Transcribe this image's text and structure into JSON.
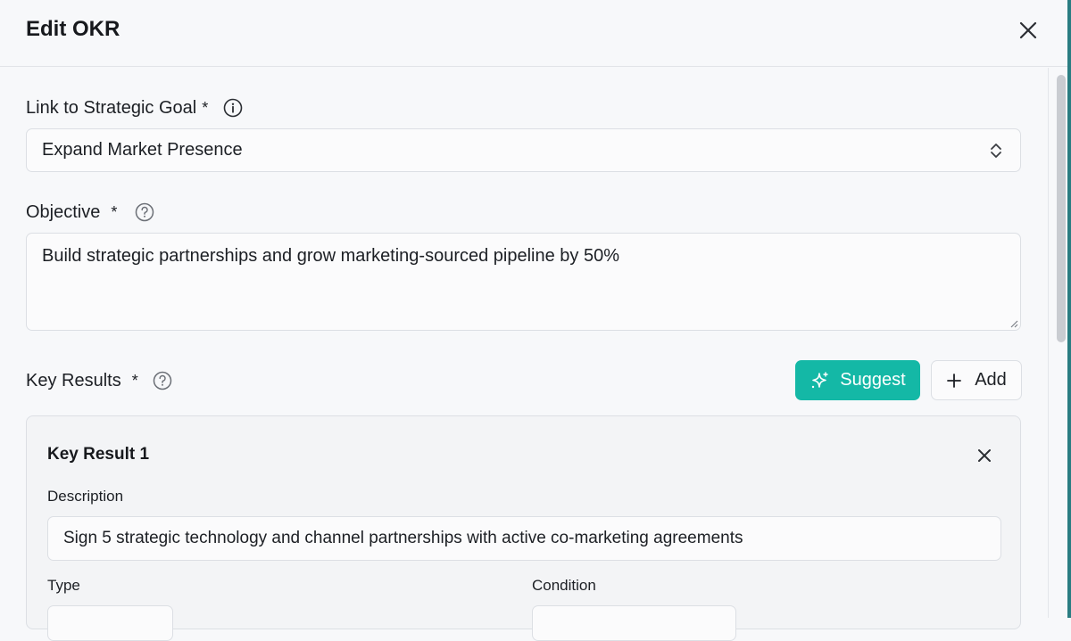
{
  "dialog": {
    "title": "Edit OKR",
    "close_icon": "close-icon"
  },
  "strategic_goal": {
    "label": "Link to Strategic Goal",
    "required_marker": "*",
    "info_icon": "info-icon",
    "selected_value": "Expand Market Presence"
  },
  "objective": {
    "label": "Objective",
    "required_marker": "*",
    "help_icon": "help-icon",
    "value": "Build strategic partnerships and grow marketing-sourced pipeline by 50%"
  },
  "key_results": {
    "label": "Key Results",
    "required_marker": "*",
    "help_icon": "help-icon",
    "suggest_label": "Suggest",
    "add_label": "Add",
    "accent_color": "#14b8a6",
    "items": [
      {
        "title": "Key Result 1",
        "description_label": "Description",
        "description_value": "Sign 5 strategic technology and channel partnerships with active co-marketing agreements",
        "type_label": "Type",
        "condition_label": "Condition"
      }
    ]
  }
}
